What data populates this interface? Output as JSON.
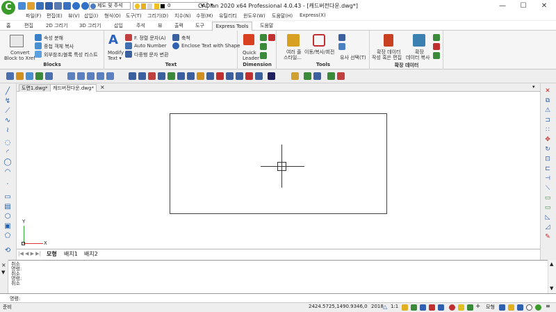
{
  "window": {
    "title": "CADian 2020 x64 Professional 4.0.43 - [캐드버전다운.dwg*]",
    "min_icon": "—",
    "max_icon": "☐",
    "close_icon": "✕"
  },
  "quick_access": {
    "style_select": "제도 및 주석",
    "layer_value": "0"
  },
  "menu": [
    "파일(F)",
    "편집(E)",
    "뷰(V)",
    "삽입(I)",
    "형식(O)",
    "도구(T)",
    "그리기(D)",
    "치수(N)",
    "수정(M)",
    "유틸리티",
    "윈도우(W)",
    "도움말(H)",
    "Express(X)"
  ],
  "ribbon_tabs": [
    "홈",
    "편집",
    "2D 그리기",
    "3D 그리기",
    "삽입",
    "주석",
    "뷰",
    "출력",
    "도구",
    "Express Tools",
    "도움말"
  ],
  "ribbon": {
    "blocks": {
      "label": "Blocks",
      "convert_line1": "Convert",
      "convert_line2": "Block to Xref",
      "item1": "속성 분해",
      "item2": "중첩 객체 복사",
      "item3": "외부참조/블록 특성 리스트"
    },
    "text": {
      "label": "Text",
      "modify_line1": "Modify",
      "modify_line2": "Text ▾",
      "item1": "F. 정렬 문자(A)",
      "item2": "Auto Number",
      "item3": "다중행 문자 변환",
      "item4": "축척",
      "item5": "Enclose Text with Shape"
    },
    "dimension": {
      "label": "Dimension",
      "quick_line1": "Quick",
      "quick_line2": "Leader"
    },
    "tools": {
      "label": "Tools",
      "item1_line1": "여러 줄",
      "item1_line2": "스타일...",
      "item2": "이동/복사/회전",
      "item3": "유사 선택(T)"
    },
    "extended_data": {
      "label": "확장 데이터",
      "item1_line1": "확장 데이터",
      "item1_line2": "작성 혹은 편집",
      "item2_line1": "확장",
      "item2_line2": "데이터 복사"
    }
  },
  "doc_tabs": [
    "도면1.dwg*",
    "캐드버전다운.dwg*"
  ],
  "doc_close": "×",
  "ucs": {
    "x": "X",
    "y": "Y"
  },
  "layout_tabs": [
    "모형",
    "배치1",
    "배치2"
  ],
  "command_history": [
    "취소",
    "명령:",
    "취소",
    "명령:",
    "취소"
  ],
  "command_prompt": "명령:",
  "status": {
    "left": "준비",
    "coords": "2424.5725,1490.9346,0",
    "year": "2018",
    "scale": "1:1",
    "model": "모형"
  }
}
